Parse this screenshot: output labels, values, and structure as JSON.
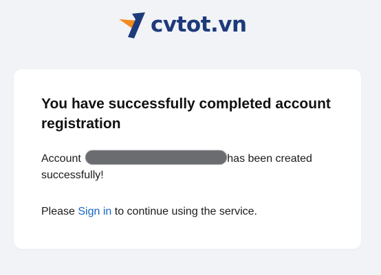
{
  "brand": {
    "name": "cvtot.vn",
    "icon": "cvtot-logo-icon",
    "colors": {
      "text": "#1e3a7b",
      "mark_orange": "#f48a1f",
      "mark_navy": "#1e3a7b"
    }
  },
  "card": {
    "title": "You have successfully completed account registration",
    "message": {
      "prefix": "Account",
      "suffix": "has been created successfully!"
    },
    "signin": {
      "before": "Please",
      "link_label": "Sign in",
      "after": "to continue using the service."
    }
  },
  "colors": {
    "background": "#f1f3f6",
    "card": "#ffffff",
    "link": "#1565c0"
  }
}
